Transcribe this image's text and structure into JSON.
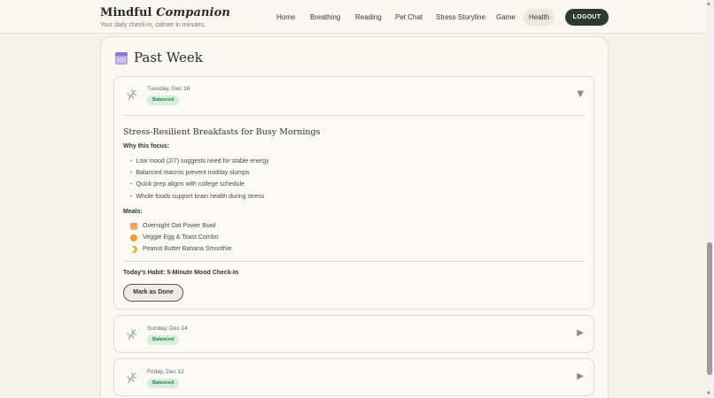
{
  "brand": {
    "title_main": "Mindful",
    "title_accent": "Companion",
    "tagline": "Your daily check-in, calmer in minutes."
  },
  "nav": {
    "items": [
      {
        "label": "Home"
      },
      {
        "label": "Breathing"
      },
      {
        "label": "Reading"
      },
      {
        "label": "Pet Chat"
      },
      {
        "label": "Stress Storyline"
      },
      {
        "label": "Game"
      },
      {
        "label": "Health",
        "active": true
      }
    ],
    "logout_label": "LOGOUT"
  },
  "section": {
    "title": "Past Week",
    "icon": "calendar-icon"
  },
  "entries": [
    {
      "date": "Tuesday, Dec 16",
      "badge": "Balanced",
      "expanded": true,
      "toggle_icon": "▼",
      "tip_title": "Stress-Resilient Breakfasts for Busy Mornings",
      "why_label": "Why this focus:",
      "why": [
        "Low mood (2/7) suggests need for stable energy",
        "Balanced macros prevent midday slumps",
        "Quick prep aligns with college schedule",
        "Whole foods support brain health during stress"
      ],
      "meals_label": "Meals:",
      "meals": [
        {
          "icon": "sunrise-icon",
          "name": "Overnight Oat Power Bowl"
        },
        {
          "icon": "sun-icon",
          "name": "Veggie Egg & Toast Combo"
        },
        {
          "icon": "moon-icon",
          "name": "Peanut Butter Banana Smoothie"
        }
      ],
      "habit": "Today's Habit: 5-Minute Mood Check-In",
      "done_label": "Mark as Done"
    },
    {
      "date": "Sunday, Dec 14",
      "badge": "Balanced",
      "expanded": false,
      "toggle_icon": "▶"
    },
    {
      "date": "Friday, Dec 12",
      "badge": "Balanced",
      "expanded": false,
      "toggle_icon": "▶"
    }
  ],
  "colors": {
    "accent_dark": "#2d3a32",
    "badge_bg": "#d4efdc",
    "badge_text": "#2f7a45",
    "leaf": "#7fa56a"
  }
}
